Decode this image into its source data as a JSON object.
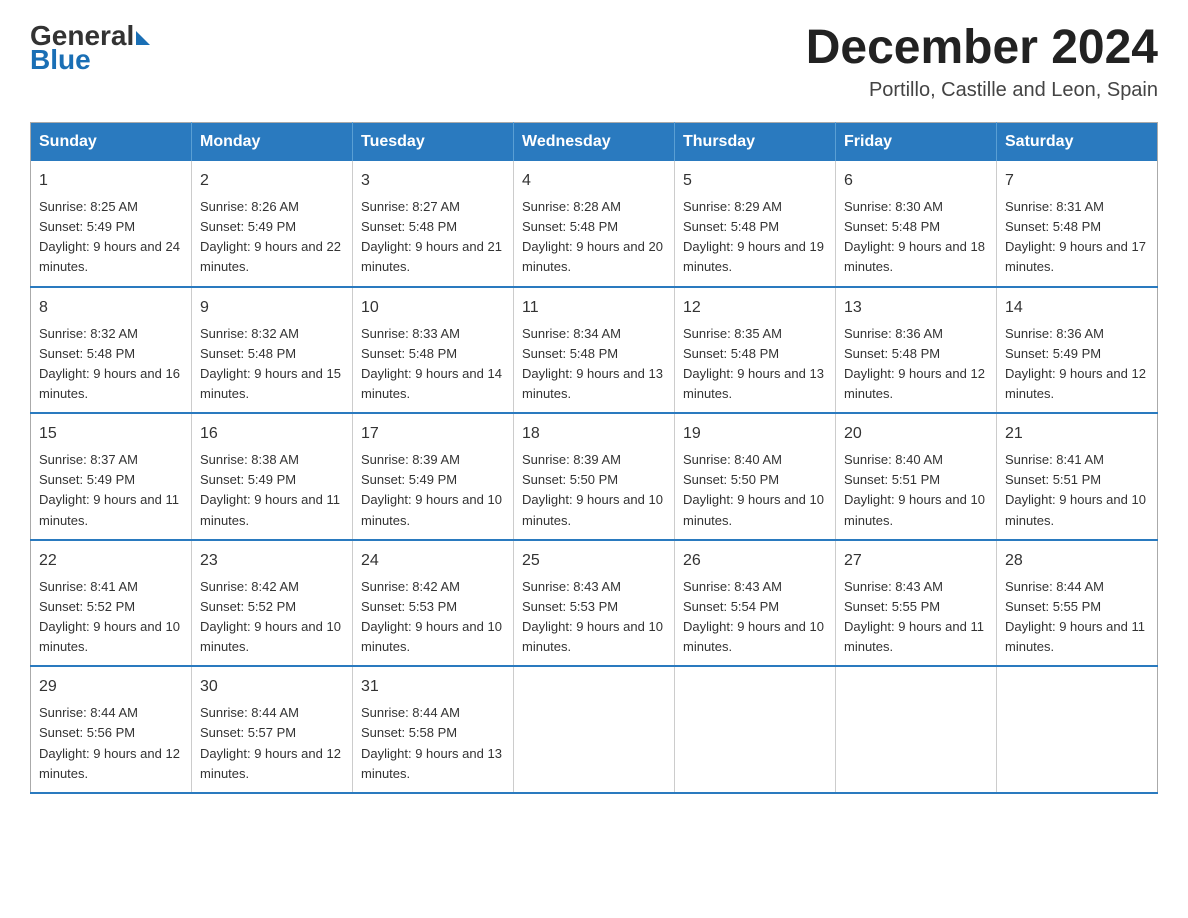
{
  "header": {
    "logo_general": "General",
    "logo_blue": "Blue",
    "month_year": "December 2024",
    "location": "Portillo, Castille and Leon, Spain"
  },
  "columns": [
    "Sunday",
    "Monday",
    "Tuesday",
    "Wednesday",
    "Thursday",
    "Friday",
    "Saturday"
  ],
  "weeks": [
    [
      {
        "day": "1",
        "sunrise": "8:25 AM",
        "sunset": "5:49 PM",
        "daylight": "9 hours and 24 minutes."
      },
      {
        "day": "2",
        "sunrise": "8:26 AM",
        "sunset": "5:49 PM",
        "daylight": "9 hours and 22 minutes."
      },
      {
        "day": "3",
        "sunrise": "8:27 AM",
        "sunset": "5:48 PM",
        "daylight": "9 hours and 21 minutes."
      },
      {
        "day": "4",
        "sunrise": "8:28 AM",
        "sunset": "5:48 PM",
        "daylight": "9 hours and 20 minutes."
      },
      {
        "day": "5",
        "sunrise": "8:29 AM",
        "sunset": "5:48 PM",
        "daylight": "9 hours and 19 minutes."
      },
      {
        "day": "6",
        "sunrise": "8:30 AM",
        "sunset": "5:48 PM",
        "daylight": "9 hours and 18 minutes."
      },
      {
        "day": "7",
        "sunrise": "8:31 AM",
        "sunset": "5:48 PM",
        "daylight": "9 hours and 17 minutes."
      }
    ],
    [
      {
        "day": "8",
        "sunrise": "8:32 AM",
        "sunset": "5:48 PM",
        "daylight": "9 hours and 16 minutes."
      },
      {
        "day": "9",
        "sunrise": "8:32 AM",
        "sunset": "5:48 PM",
        "daylight": "9 hours and 15 minutes."
      },
      {
        "day": "10",
        "sunrise": "8:33 AM",
        "sunset": "5:48 PM",
        "daylight": "9 hours and 14 minutes."
      },
      {
        "day": "11",
        "sunrise": "8:34 AM",
        "sunset": "5:48 PM",
        "daylight": "9 hours and 13 minutes."
      },
      {
        "day": "12",
        "sunrise": "8:35 AM",
        "sunset": "5:48 PM",
        "daylight": "9 hours and 13 minutes."
      },
      {
        "day": "13",
        "sunrise": "8:36 AM",
        "sunset": "5:48 PM",
        "daylight": "9 hours and 12 minutes."
      },
      {
        "day": "14",
        "sunrise": "8:36 AM",
        "sunset": "5:49 PM",
        "daylight": "9 hours and 12 minutes."
      }
    ],
    [
      {
        "day": "15",
        "sunrise": "8:37 AM",
        "sunset": "5:49 PM",
        "daylight": "9 hours and 11 minutes."
      },
      {
        "day": "16",
        "sunrise": "8:38 AM",
        "sunset": "5:49 PM",
        "daylight": "9 hours and 11 minutes."
      },
      {
        "day": "17",
        "sunrise": "8:39 AM",
        "sunset": "5:49 PM",
        "daylight": "9 hours and 10 minutes."
      },
      {
        "day": "18",
        "sunrise": "8:39 AM",
        "sunset": "5:50 PM",
        "daylight": "9 hours and 10 minutes."
      },
      {
        "day": "19",
        "sunrise": "8:40 AM",
        "sunset": "5:50 PM",
        "daylight": "9 hours and 10 minutes."
      },
      {
        "day": "20",
        "sunrise": "8:40 AM",
        "sunset": "5:51 PM",
        "daylight": "9 hours and 10 minutes."
      },
      {
        "day": "21",
        "sunrise": "8:41 AM",
        "sunset": "5:51 PM",
        "daylight": "9 hours and 10 minutes."
      }
    ],
    [
      {
        "day": "22",
        "sunrise": "8:41 AM",
        "sunset": "5:52 PM",
        "daylight": "9 hours and 10 minutes."
      },
      {
        "day": "23",
        "sunrise": "8:42 AM",
        "sunset": "5:52 PM",
        "daylight": "9 hours and 10 minutes."
      },
      {
        "day": "24",
        "sunrise": "8:42 AM",
        "sunset": "5:53 PM",
        "daylight": "9 hours and 10 minutes."
      },
      {
        "day": "25",
        "sunrise": "8:43 AM",
        "sunset": "5:53 PM",
        "daylight": "9 hours and 10 minutes."
      },
      {
        "day": "26",
        "sunrise": "8:43 AM",
        "sunset": "5:54 PM",
        "daylight": "9 hours and 10 minutes."
      },
      {
        "day": "27",
        "sunrise": "8:43 AM",
        "sunset": "5:55 PM",
        "daylight": "9 hours and 11 minutes."
      },
      {
        "day": "28",
        "sunrise": "8:44 AM",
        "sunset": "5:55 PM",
        "daylight": "9 hours and 11 minutes."
      }
    ],
    [
      {
        "day": "29",
        "sunrise": "8:44 AM",
        "sunset": "5:56 PM",
        "daylight": "9 hours and 12 minutes."
      },
      {
        "day": "30",
        "sunrise": "8:44 AM",
        "sunset": "5:57 PM",
        "daylight": "9 hours and 12 minutes."
      },
      {
        "day": "31",
        "sunrise": "8:44 AM",
        "sunset": "5:58 PM",
        "daylight": "9 hours and 13 minutes."
      },
      null,
      null,
      null,
      null
    ]
  ]
}
